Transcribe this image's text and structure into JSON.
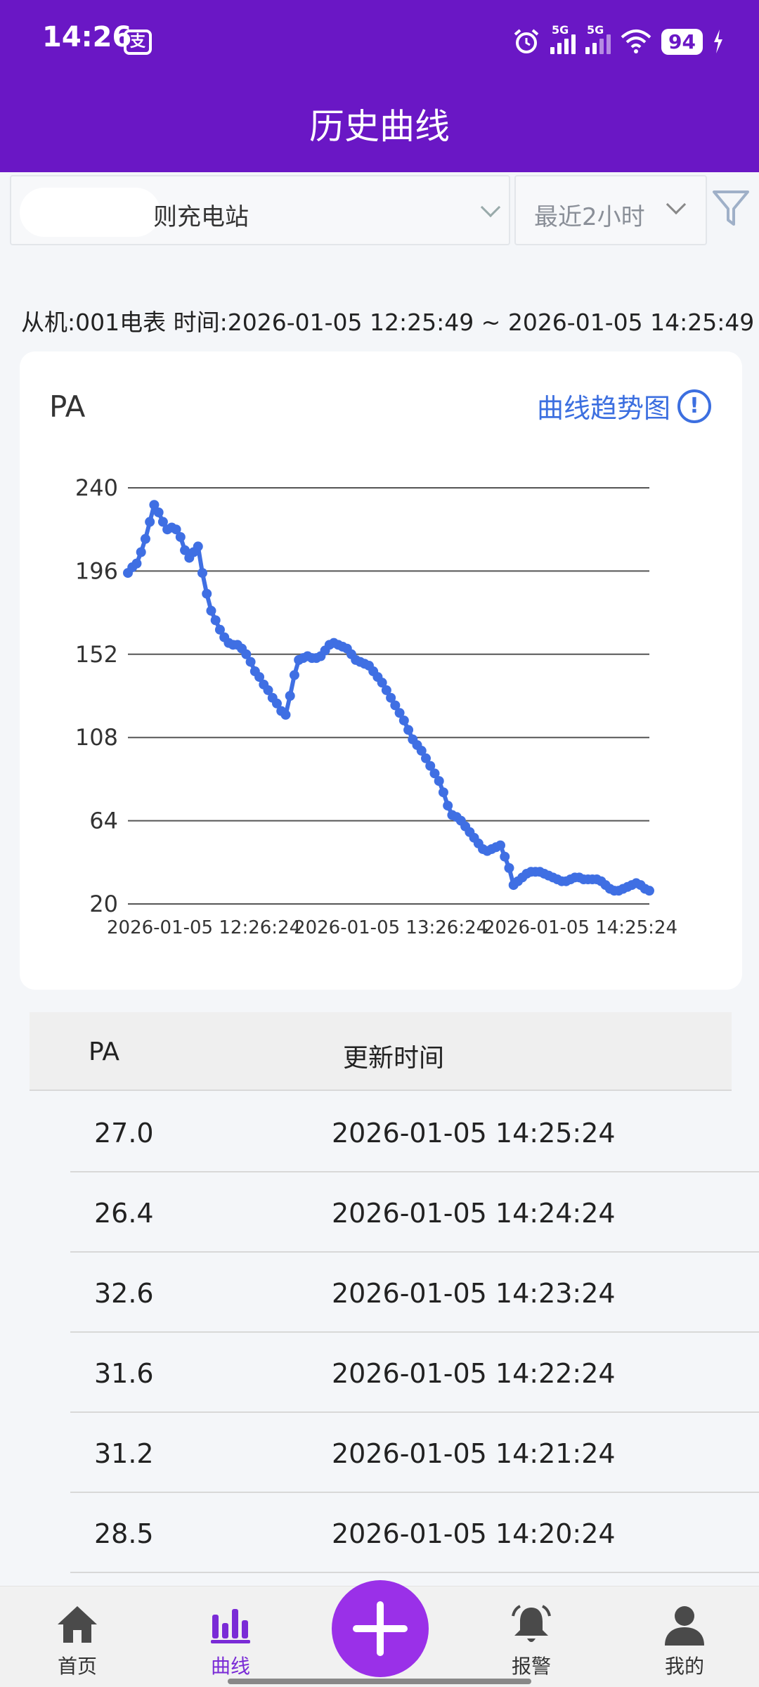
{
  "status": {
    "time": "14:26",
    "network1": "5G",
    "network2": "5G",
    "battery": "94"
  },
  "header": {
    "title": "历史曲线"
  },
  "filters": {
    "station": "则充电站",
    "range": "最近2小时"
  },
  "info": {
    "text": "从机:001电表   时间:2026-01-05 12:25:49 ~ 2026-01-05 14:25:49"
  },
  "card": {
    "label": "PA",
    "trend_label": "曲线趋势图",
    "info_glyph": "!"
  },
  "chart_data": {
    "type": "line",
    "x_start": "2026-01-05 12:26:24",
    "x_end": "2026-01-05 14:25:24",
    "x_step_minutes": 1,
    "ylim": [
      20,
      240
    ],
    "yticks": [
      20,
      64,
      108,
      152,
      196,
      240
    ],
    "xtick_labels": [
      "2026-01-05 12:26:24",
      "2026-01-05 13:26:24",
      "2026-01-05 14:25:24"
    ],
    "grid": true,
    "color": "#3f6fe3",
    "values": [
      195,
      198,
      200,
      206,
      213,
      222,
      231,
      227,
      222,
      218,
      219,
      218,
      214,
      207,
      203,
      206,
      209,
      195,
      184,
      175,
      170,
      165,
      161,
      158,
      157,
      157,
      155,
      152,
      148,
      143,
      140,
      136,
      133,
      129,
      126,
      122,
      120,
      130,
      141,
      149,
      150,
      151,
      150,
      150,
      151,
      154,
      157,
      158,
      157,
      156,
      155,
      152,
      149,
      148,
      147,
      146,
      143,
      140,
      137,
      133,
      129,
      125,
      121,
      117,
      112,
      107,
      104,
      101,
      97,
      93,
      89,
      85,
      79,
      72,
      67,
      66,
      64,
      61,
      58,
      55,
      52,
      49,
      48,
      49,
      50,
      51,
      45,
      39,
      30,
      32,
      34,
      36,
      37,
      37,
      37,
      36,
      35,
      34,
      33,
      32,
      32,
      33,
      34,
      34,
      33,
      33,
      33,
      33,
      32,
      30,
      28,
      27,
      27,
      28,
      29,
      30,
      31,
      30,
      28,
      27
    ]
  },
  "table": {
    "headers": [
      "PA",
      "更新时间"
    ],
    "rows": [
      {
        "value": "27.0",
        "time": "2026-01-05 14:25:24"
      },
      {
        "value": "26.4",
        "time": "2026-01-05 14:24:24"
      },
      {
        "value": "32.6",
        "time": "2026-01-05 14:23:24"
      },
      {
        "value": "31.6",
        "time": "2026-01-05 14:22:24"
      },
      {
        "value": "31.2",
        "time": "2026-01-05 14:21:24"
      },
      {
        "value": "28.5",
        "time": "2026-01-05 14:20:24"
      }
    ]
  },
  "tabs": [
    {
      "label": "首页",
      "icon": "home-icon"
    },
    {
      "label": "曲线",
      "icon": "bar-chart-icon",
      "active": true
    },
    {
      "label": "报警",
      "icon": "bell-icon"
    },
    {
      "label": "我的",
      "icon": "user-icon"
    }
  ],
  "colors": {
    "primary": "#6a17c5",
    "accent": "#3f6fe3",
    "fab": "#9a30e8"
  }
}
